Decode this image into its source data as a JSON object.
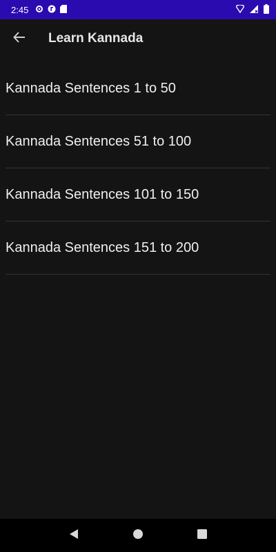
{
  "status_bar": {
    "time": "2:45",
    "icons": [
      "settings-icon",
      "media-icon",
      "sd-card-icon",
      "wifi-icon",
      "signal-icon",
      "battery-icon"
    ]
  },
  "app_bar": {
    "back_icon": "arrow-back-icon",
    "title": "Learn Kannada"
  },
  "list": {
    "items": [
      {
        "label": "Kannada Sentences 1 to 50"
      },
      {
        "label": "Kannada Sentences 51 to 100"
      },
      {
        "label": "Kannada Sentences 101 to 150"
      },
      {
        "label": "Kannada Sentences 151 to 200"
      }
    ]
  },
  "nav_bar": {
    "icons": [
      "back-triangle-icon",
      "home-circle-icon",
      "recents-square-icon"
    ]
  },
  "colors": {
    "status_bar": "#2a0bb0",
    "background": "#141414",
    "divider": "#333333",
    "text": "#f0f0f0"
  }
}
